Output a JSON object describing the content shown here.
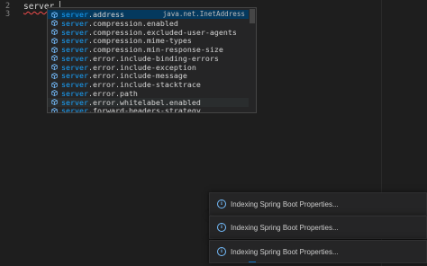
{
  "editor": {
    "line_numbers": [
      "2",
      "3"
    ],
    "code_line": "server."
  },
  "suggest": {
    "prefix": "server",
    "items": [
      {
        "match": "server",
        "rest": ".address",
        "detail": "java.net.InetAddress"
      },
      {
        "match": "server",
        "rest": ".compression.enabled",
        "detail": ""
      },
      {
        "match": "server",
        "rest": ".compression.excluded-user-agents",
        "detail": ""
      },
      {
        "match": "server",
        "rest": ".compression.mime-types",
        "detail": ""
      },
      {
        "match": "server",
        "rest": ".compression.min-response-size",
        "detail": ""
      },
      {
        "match": "server",
        "rest": ".error.include-binding-errors",
        "detail": ""
      },
      {
        "match": "server",
        "rest": ".error.include-exception",
        "detail": ""
      },
      {
        "match": "server",
        "rest": ".error.include-message",
        "detail": ""
      },
      {
        "match": "server",
        "rest": ".error.include-stacktrace",
        "detail": ""
      },
      {
        "match": "server",
        "rest": ".error.path",
        "detail": ""
      },
      {
        "match": "server",
        "rest": ".error.whitelabel.enabled",
        "detail": ""
      },
      {
        "match": "server",
        "rest": ".forward-headers-strategy",
        "detail": ""
      }
    ],
    "icon": "property-icon",
    "selected_index": 0
  },
  "notifications": [
    {
      "icon": "info-icon",
      "text": "Indexing Spring Boot Properties..."
    },
    {
      "icon": "info-icon",
      "text": "Indexing Spring Boot Properties..."
    },
    {
      "icon": "info-icon",
      "text": "Indexing Spring Boot Properties..."
    }
  ],
  "colors": {
    "background": "#1e1e1e",
    "match_highlight": "#18a3ff",
    "selected_row": "#04395e",
    "info_icon": "#75beff"
  }
}
